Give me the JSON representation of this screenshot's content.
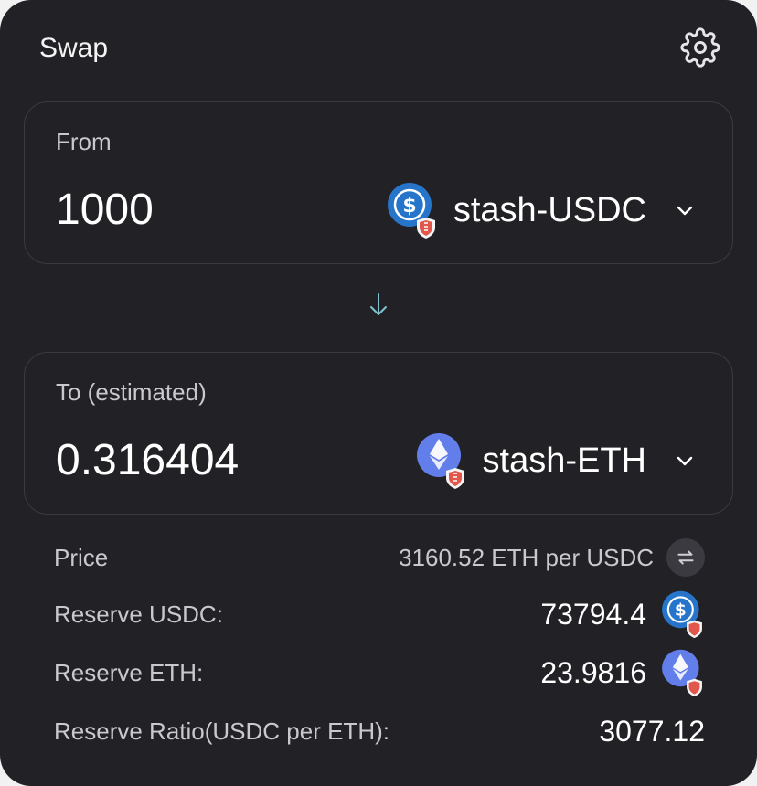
{
  "header": {
    "title": "Swap"
  },
  "from": {
    "label": "From",
    "amount": "1000",
    "token": "stash-USDC",
    "token_icon": "usdc-coin-icon",
    "badge_icon": "shield-badge-icon"
  },
  "direction_icon": "arrow-down-icon",
  "to": {
    "label": "To (estimated)",
    "amount": "0.316404",
    "token": "stash-ETH",
    "token_icon": "eth-coin-icon",
    "badge_icon": "shield-badge-icon"
  },
  "details": {
    "price": {
      "label": "Price",
      "value": "3160.52 ETH per USDC"
    },
    "reserve_usdc": {
      "label": "Reserve USDC:",
      "value": "73794.4"
    },
    "reserve_eth": {
      "label": "Reserve ETH:",
      "value": "23.9816"
    },
    "reserve_ratio": {
      "label": "Reserve Ratio(USDC per ETH):",
      "value": "3077.12"
    }
  },
  "colors": {
    "background": "#222226",
    "panel_border": "#3a3a40",
    "usdc_blue": "#2775ca",
    "eth_purple": "#627eea",
    "badge_red": "#e2574c",
    "accent_teal": "#7fc4d0"
  }
}
